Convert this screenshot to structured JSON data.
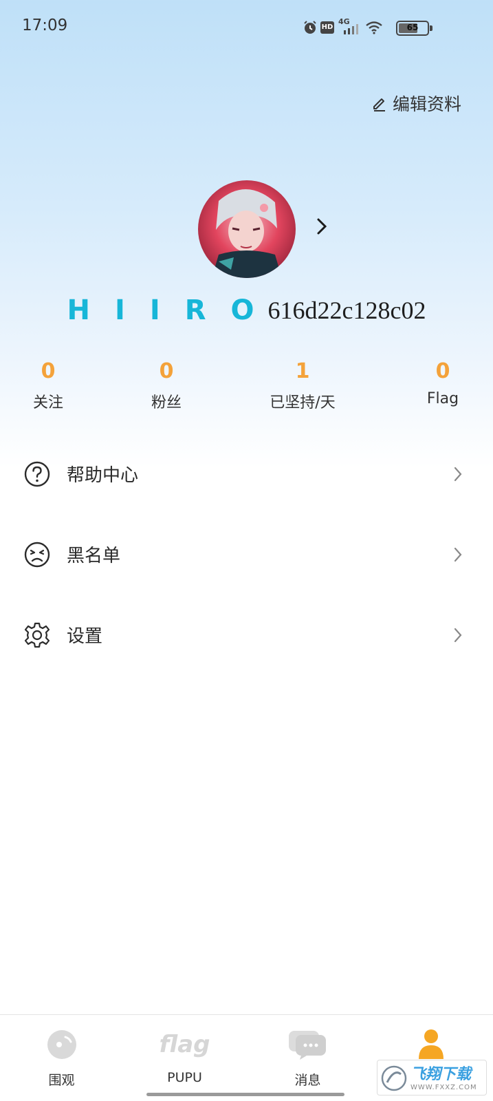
{
  "status_bar": {
    "time": "17:09",
    "network": "4G",
    "hd_badge": "HD",
    "battery": "65",
    "battery_level": 0.65
  },
  "header": {
    "edit_label": "编辑资料"
  },
  "profile": {
    "name_logo": "HIIRO",
    "user_id": "616d22c128c02"
  },
  "stats": [
    {
      "value": "0",
      "label": "关注"
    },
    {
      "value": "0",
      "label": "粉丝"
    },
    {
      "value": "1",
      "label": "已坚持/天"
    },
    {
      "value": "0",
      "label": "Flag"
    }
  ],
  "menu": [
    {
      "label": "帮助中心",
      "icon": "help-circle-icon"
    },
    {
      "label": "黑名单",
      "icon": "frown-face-icon"
    },
    {
      "label": "设置",
      "icon": "gear-icon"
    }
  ],
  "tabs": [
    {
      "label": "围观",
      "icon": "watch-icon"
    },
    {
      "label": "PUPU",
      "icon": "flag-text-icon",
      "icon_text": "flag"
    },
    {
      "label": "消息",
      "icon": "chat-bubble-icon"
    },
    {
      "label": "",
      "icon": "person-icon",
      "active": true
    }
  ],
  "colors": {
    "accent": "#f4a23a",
    "brand_cyan": "#17b6d8",
    "tab_inactive": "#d6d6d6"
  },
  "watermark": {
    "text": "飞翔下载",
    "domain": "WWW.FXXZ.COM"
  }
}
